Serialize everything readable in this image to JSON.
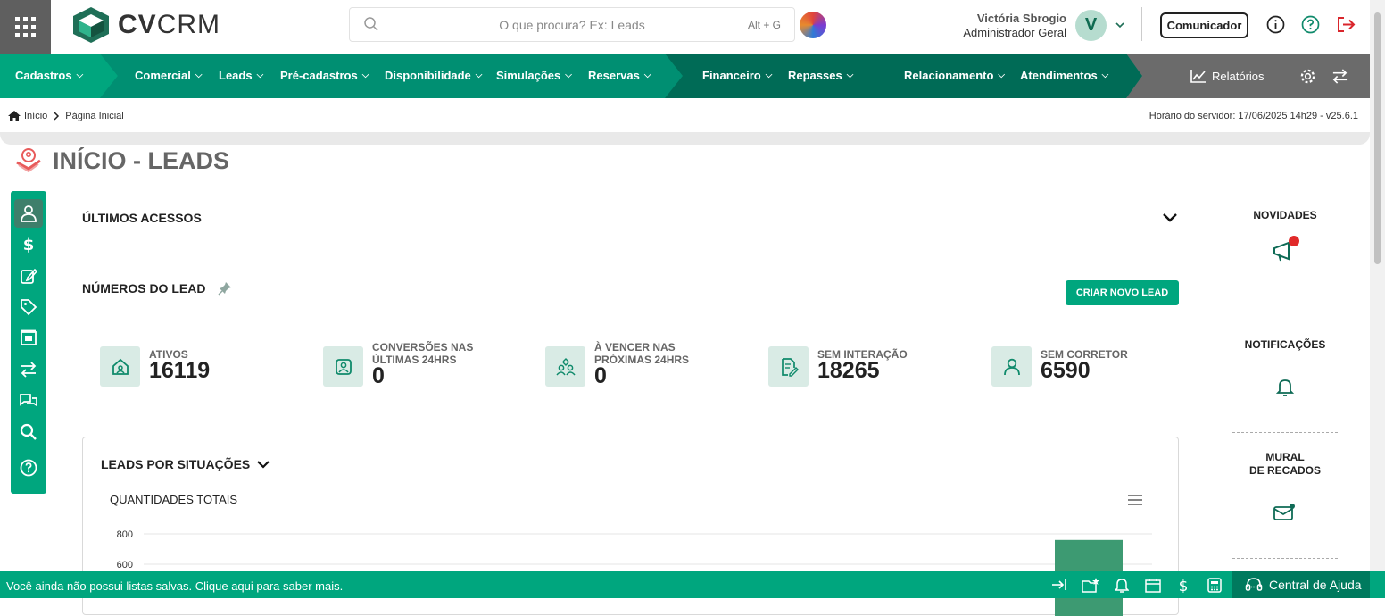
{
  "header": {
    "logo_bold": "CV",
    "logo_light": "CRM",
    "search_placeholder": "O que procura? Ex: Leads",
    "search_shortcut": "Alt + G",
    "user_name": "Victória Sbrogio",
    "user_role": "Administrador Geral",
    "avatar_letter": "V",
    "comunicador_label": "Comunicador"
  },
  "nav": {
    "items": [
      {
        "label": "Cadastros"
      },
      {
        "label": "Comercial"
      },
      {
        "label": "Leads"
      },
      {
        "label": "Pré-cadastros"
      },
      {
        "label": "Disponibilidade"
      },
      {
        "label": "Simulações"
      },
      {
        "label": "Reservas"
      },
      {
        "label": "Financeiro"
      },
      {
        "label": "Repasses"
      },
      {
        "label": "Relacionamento"
      },
      {
        "label": "Atendimentos"
      }
    ],
    "reports_label": "Relatórios",
    "colors": {
      "green1": "#00a67e",
      "green2": "#008f72",
      "green3": "#006b56",
      "gray": "#6b6b6b"
    }
  },
  "breadcrumb": {
    "home": "Início",
    "current": "Página Inicial",
    "server_time": "Horário do servidor: 17/06/2025 14h29 - v25.6.1"
  },
  "page": {
    "title": "INÍCIO - LEADS"
  },
  "sections": {
    "ultimos_acessos": "ÚLTIMOS ACESSOS",
    "numeros_lead": "NÚMEROS DO LEAD",
    "create_lead": "CRIAR NOVO LEAD"
  },
  "stats": [
    {
      "label_1": "ATIVOS",
      "label_2": "",
      "value": "16119",
      "icon": "house-icon"
    },
    {
      "label_1": "CONVERSÕES NAS",
      "label_2": "ÚLTIMAS 24HRS",
      "value": "0",
      "icon": "badge-user-icon"
    },
    {
      "label_1": "À VENCER NAS",
      "label_2": "PRÓXIMAS 24HRS",
      "value": "0",
      "icon": "users-swap-icon"
    },
    {
      "label_1": "SEM INTERAÇÃO",
      "label_2": "",
      "value": "18265",
      "icon": "doc-edit-icon"
    },
    {
      "label_1": "SEM CORRETOR",
      "label_2": "",
      "value": "6590",
      "icon": "user-icon"
    }
  ],
  "chart": {
    "section_title": "LEADS POR SITUAÇÕES",
    "subtitle": "QUANTIDADES TOTAIS",
    "y_ticks": [
      "800",
      "600"
    ]
  },
  "chart_data": {
    "type": "bar",
    "title": "QUANTIDADES TOTAIS",
    "y_ticks": [
      600,
      800
    ],
    "ylim": [
      0,
      800
    ],
    "categories": [
      ""
    ],
    "values": [
      760
    ],
    "grid": true
  },
  "right_panel": {
    "novidades": "NOVIDADES",
    "notificacoes": "NOTIFICAÇÕES",
    "mural_1": "MURAL",
    "mural_2": "DE RECADOS"
  },
  "footer": {
    "message": "Você ainda não possui listas salvas. Clique aqui para saber mais.",
    "help_label": "Central de Ajuda"
  }
}
